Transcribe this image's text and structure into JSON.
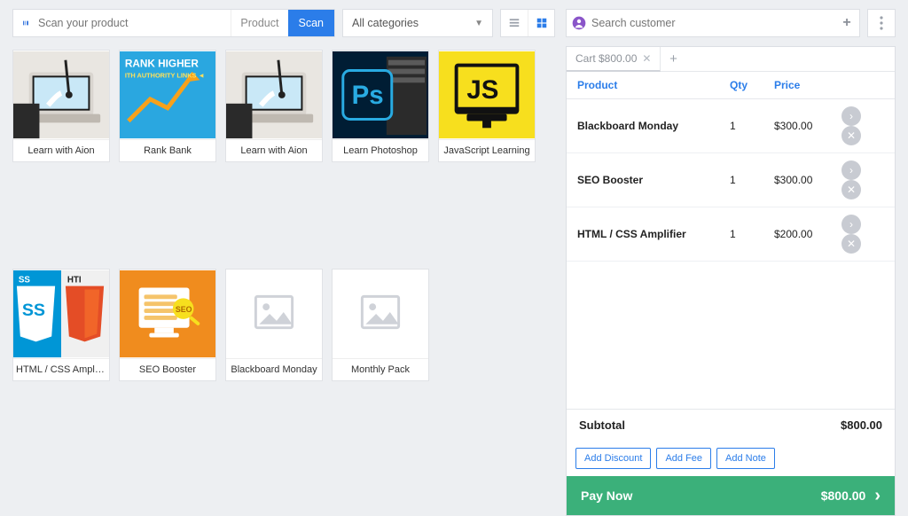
{
  "search": {
    "placeholder": "Scan your product",
    "mode_label": "Product",
    "scan_label": "Scan"
  },
  "categories": {
    "selected": "All categories"
  },
  "products": [
    {
      "name": "Learn with Aion",
      "thumb": "aion"
    },
    {
      "name": "Rank Bank",
      "thumb": "rank"
    },
    {
      "name": "Learn with Aion",
      "thumb": "aion"
    },
    {
      "name": "Learn Photoshop",
      "thumb": "ps"
    },
    {
      "name": "JavaScript Learning",
      "thumb": "js"
    },
    {
      "name": "HTML / CSS Amplifier",
      "thumb": "htmlcss"
    },
    {
      "name": "SEO Booster",
      "thumb": "seo"
    },
    {
      "name": "Blackboard Monday",
      "thumb": "placeholder"
    },
    {
      "name": "Monthly Pack",
      "thumb": "placeholder"
    }
  ],
  "customer_search": {
    "placeholder": "Search customer"
  },
  "cart": {
    "tab_label": "Cart $800.00",
    "headers": {
      "product": "Product",
      "qty": "Qty",
      "price": "Price"
    },
    "items": [
      {
        "name": "Blackboard Monday",
        "qty": "1",
        "price": "$300.00"
      },
      {
        "name": "SEO Booster",
        "qty": "1",
        "price": "$300.00"
      },
      {
        "name": "HTML / CSS Amplifier",
        "qty": "1",
        "price": "$200.00"
      }
    ],
    "subtotal_label": "Subtotal",
    "subtotal_value": "$800.00",
    "add_discount": "Add Discount",
    "add_fee": "Add Fee",
    "add_note": "Add Note",
    "pay_label": "Pay Now",
    "pay_amount": "$800.00"
  }
}
